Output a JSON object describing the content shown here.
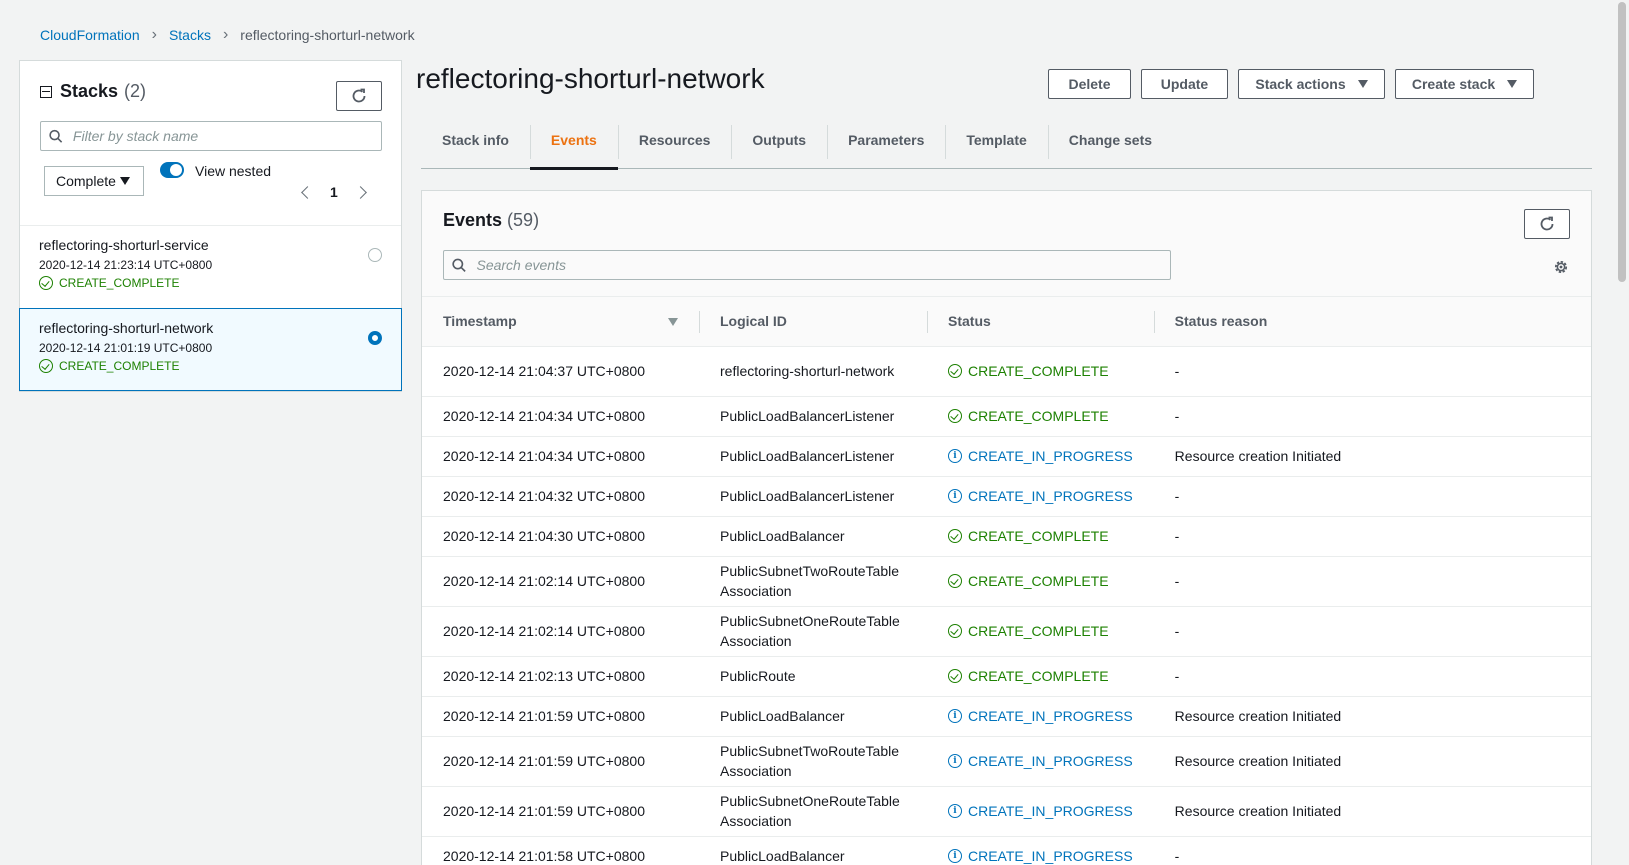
{
  "breadcrumb": {
    "items": [
      "CloudFormation",
      "Stacks"
    ],
    "current": "reflectoring-shorturl-network"
  },
  "stacks_panel": {
    "title": "Stacks",
    "count": "(2)",
    "search_placeholder": "Filter by stack name",
    "filter_value": "Complete",
    "toggle_label": "View nested",
    "page": "1",
    "items": [
      {
        "name": "reflectoring-shorturl-service",
        "date": "2020-12-14 21:23:14 UTC+0800",
        "status": "CREATE_COMPLETE"
      },
      {
        "name": "reflectoring-shorturl-network",
        "date": "2020-12-14 21:01:19 UTC+0800",
        "status": "CREATE_COMPLETE"
      }
    ]
  },
  "header": {
    "title": "reflectoring-shorturl-network",
    "buttons": {
      "delete": "Delete",
      "update": "Update",
      "stack_actions": "Stack actions",
      "create_stack": "Create stack"
    }
  },
  "tabs": [
    "Stack info",
    "Events",
    "Resources",
    "Outputs",
    "Parameters",
    "Template",
    "Change sets"
  ],
  "events": {
    "title": "Events",
    "count": "(59)",
    "search_placeholder": "Search events",
    "columns": [
      "Timestamp",
      "Logical ID",
      "Status",
      "Status reason"
    ],
    "rows": [
      {
        "timestamp": "2020-12-14 21:04:37 UTC+0800",
        "logical_id": "reflectoring-shorturl-network",
        "status": "CREATE_COMPLETE",
        "reason": "-"
      },
      {
        "timestamp": "2020-12-14 21:04:34 UTC+0800",
        "logical_id": "PublicLoadBalancerListener",
        "status": "CREATE_COMPLETE",
        "reason": "-"
      },
      {
        "timestamp": "2020-12-14 21:04:34 UTC+0800",
        "logical_id": "PublicLoadBalancerListener",
        "status": "CREATE_IN_PROGRESS",
        "reason": "Resource creation Initiated"
      },
      {
        "timestamp": "2020-12-14 21:04:32 UTC+0800",
        "logical_id": "PublicLoadBalancerListener",
        "status": "CREATE_IN_PROGRESS",
        "reason": "-"
      },
      {
        "timestamp": "2020-12-14 21:04:30 UTC+0800",
        "logical_id": "PublicLoadBalancer",
        "status": "CREATE_COMPLETE",
        "reason": "-"
      },
      {
        "timestamp": "2020-12-14 21:02:14 UTC+0800",
        "logical_id": "PublicSubnetTwoRouteTableAssociation",
        "status": "CREATE_COMPLETE",
        "reason": "-"
      },
      {
        "timestamp": "2020-12-14 21:02:14 UTC+0800",
        "logical_id": "PublicSubnetOneRouteTableAssociation",
        "status": "CREATE_COMPLETE",
        "reason": "-"
      },
      {
        "timestamp": "2020-12-14 21:02:13 UTC+0800",
        "logical_id": "PublicRoute",
        "status": "CREATE_COMPLETE",
        "reason": "-"
      },
      {
        "timestamp": "2020-12-14 21:01:59 UTC+0800",
        "logical_id": "PublicLoadBalancer",
        "status": "CREATE_IN_PROGRESS",
        "reason": "Resource creation Initiated"
      },
      {
        "timestamp": "2020-12-14 21:01:59 UTC+0800",
        "logical_id": "PublicSubnetTwoRouteTableAssociation",
        "status": "CREATE_IN_PROGRESS",
        "reason": "Resource creation Initiated"
      },
      {
        "timestamp": "2020-12-14 21:01:59 UTC+0800",
        "logical_id": "PublicSubnetOneRouteTableAssociation",
        "status": "CREATE_IN_PROGRESS",
        "reason": "Resource creation Initiated"
      },
      {
        "timestamp": "2020-12-14 21:01:58 UTC+0800",
        "logical_id": "PublicLoadBalancer",
        "status": "CREATE_IN_PROGRESS",
        "reason": "-"
      }
    ]
  },
  "colors": {
    "link": "#0073bb",
    "success": "#1d8102",
    "active_tab": "#ec7211",
    "text": "#16191f"
  }
}
